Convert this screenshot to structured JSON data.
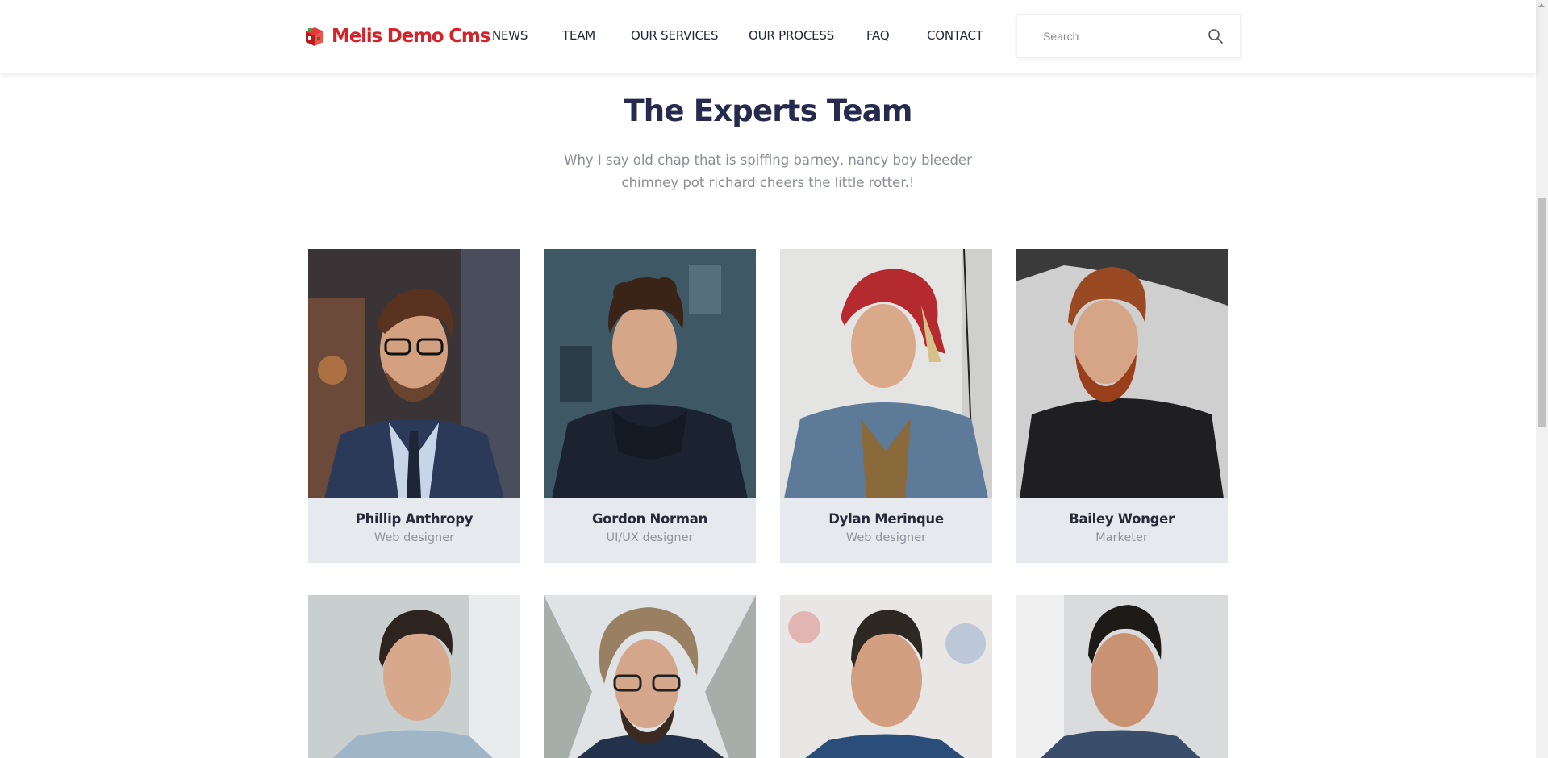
{
  "brand": {
    "name": "Melis Demo Cms"
  },
  "nav": {
    "items": [
      {
        "label": "NEWS"
      },
      {
        "label": "TEAM"
      },
      {
        "label": "OUR SERVICES"
      },
      {
        "label": "OUR PROCESS"
      },
      {
        "label": "FAQ"
      },
      {
        "label": "CONTACT"
      }
    ]
  },
  "search": {
    "placeholder": "Search",
    "icon": "search-icon"
  },
  "section": {
    "title": "The Experts Team",
    "description": "Why I say old chap that is spiffing barney, nancy boy bleeder chimney pot richard cheers the little rotter.!"
  },
  "team": [
    {
      "name": "Phillip Anthropy",
      "role": "Web designer"
    },
    {
      "name": "Gordon Norman",
      "role": "UI/UX designer"
    },
    {
      "name": "Dylan Merinque",
      "role": "Web designer"
    },
    {
      "name": "Bailey Wonger",
      "role": "Marketer"
    }
  ],
  "colors": {
    "brand": "#d6232a",
    "heading": "#262a4d",
    "card_background": "#e6e9ee"
  }
}
